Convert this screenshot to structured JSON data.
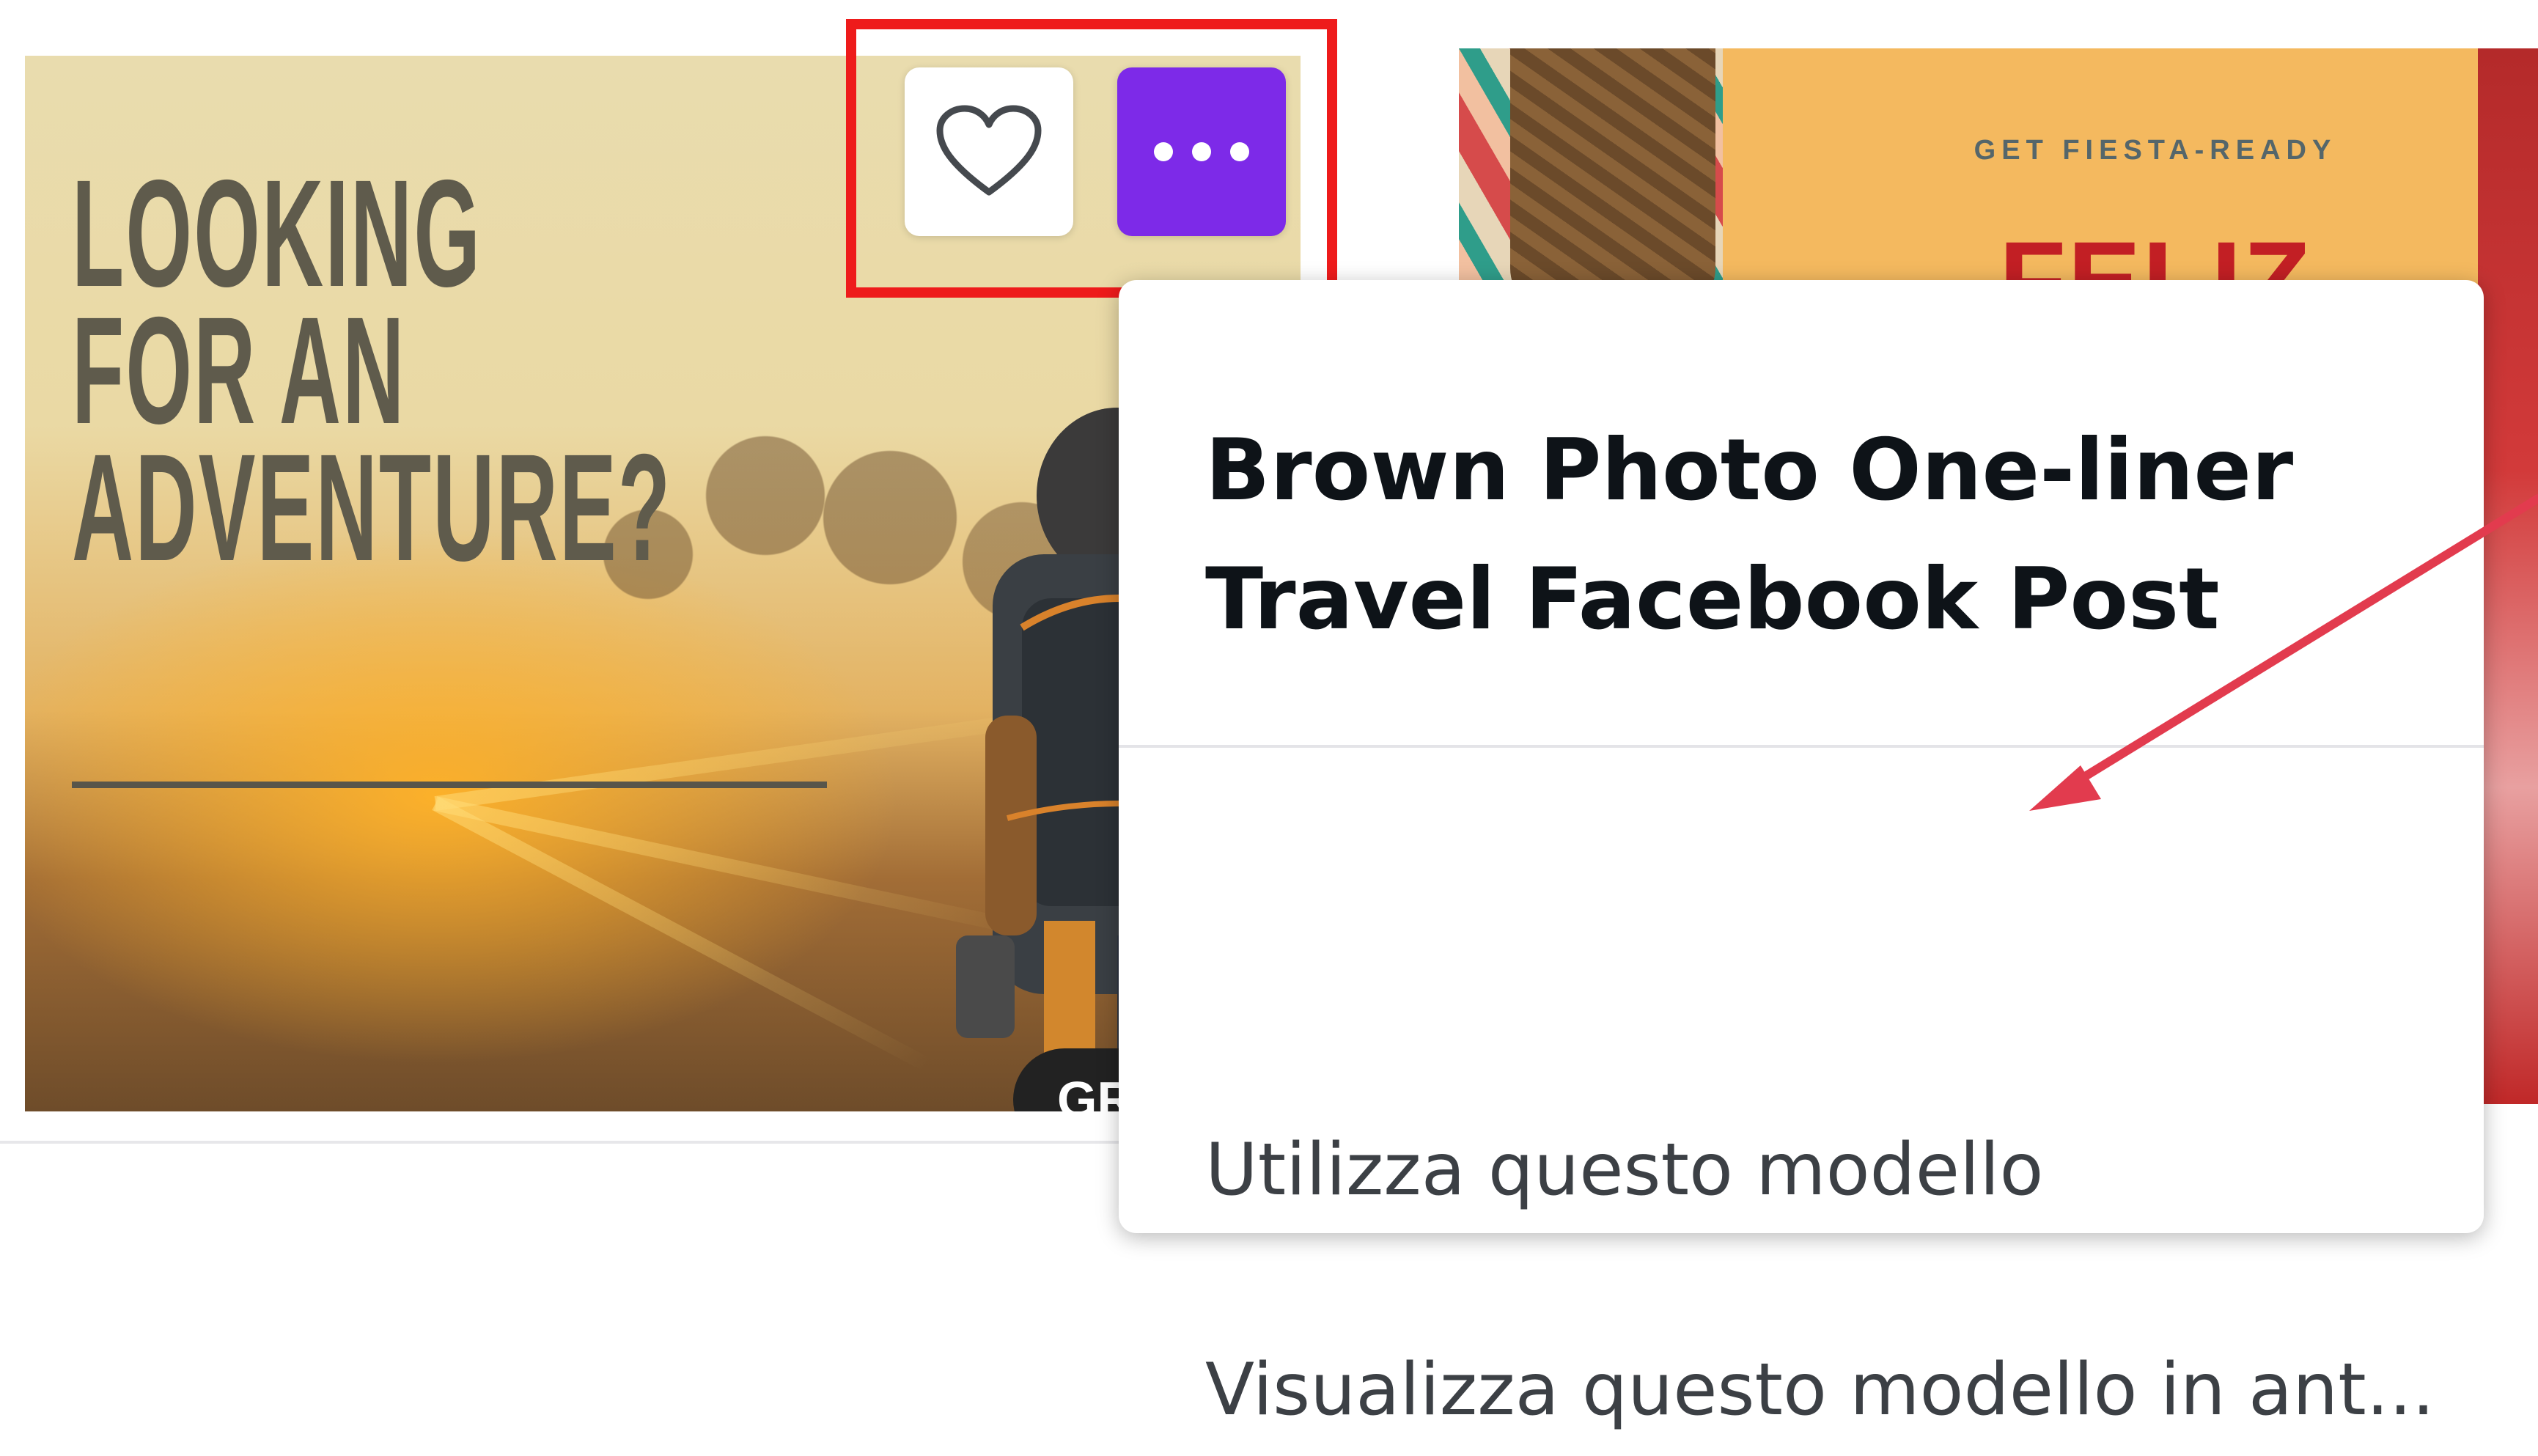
{
  "card_left": {
    "headline_lines": [
      "LOOKING",
      "FOR AN",
      "ADVENTURE?"
    ],
    "badge_text": "GR"
  },
  "card_right": {
    "kicker": "GET FIESTA-READY",
    "title": "FELIZ"
  },
  "hover_buttons": {
    "favorite_icon": "heart-icon",
    "more_icon": "ellipsis-icon"
  },
  "popup": {
    "title_lines": [
      "Brown Photo One-liner",
      "Travel Facebook Post"
    ],
    "items": [
      {
        "label": "Utilizza questo modello"
      },
      {
        "label": "Visualizza questo modello in ant..."
      }
    ]
  },
  "colors": {
    "accent_purple": "#7d2ae8",
    "highlight_red": "#ee1b1b",
    "arrow_red": "#e23b4e",
    "fiesta_red": "#c21f24"
  }
}
